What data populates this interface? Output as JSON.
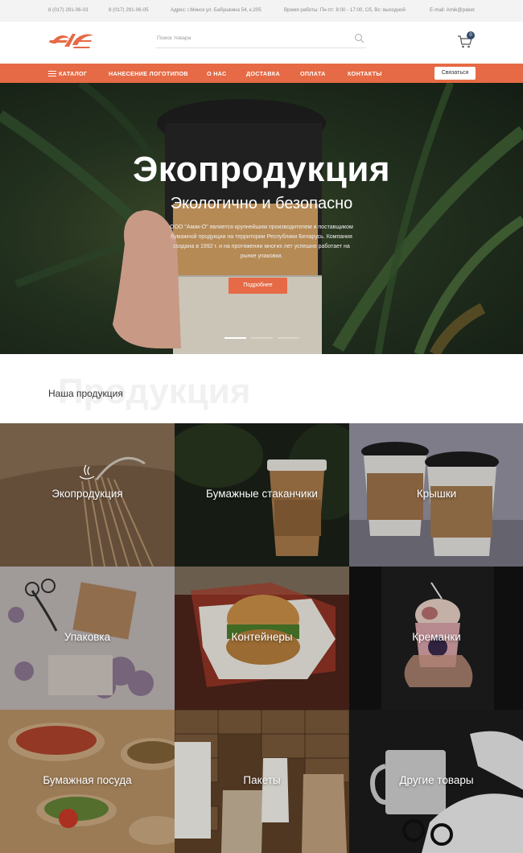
{
  "topbar": {
    "phone1": "8 (017) 291-06-03",
    "phone2": "8 (017) 291-06-05",
    "address": "Адрес: г.Минск ул. Бабушкина 54, к.205",
    "hours": "Время работы: Пн-пт: 8:00 - 17:00, Сб, Вс: выходной",
    "email": "E-mail: Amik@paket"
  },
  "header": {
    "search_placeholder": "Поиск товара",
    "cart_count": "0"
  },
  "nav": {
    "catalog": "КАТАЛОГ",
    "logos": "НАНЕСЕНИЕ ЛОГОТИПОВ",
    "about": "О НАС",
    "delivery": "ДОСТАВКА",
    "payment": "ОПЛАТА",
    "contacts": "КОНТАКТЫ",
    "contact_button": "Связаться"
  },
  "hero": {
    "title": "Экопродукция",
    "subtitle": "Экологично и безопасно",
    "text": "ООО \"Амик-О\" является крупнейшим производителем и поставщиком бумажной продукции на территории Республики Беларусь. Компания создана в 1992 г. и на протяжении многих лет успешно работает на рынке упаковки.",
    "button": "Подробнее",
    "slides_active_index": 0
  },
  "products": {
    "bg_text": "Продукция",
    "title": "Наша продукция",
    "items": [
      {
        "label": "Экопродукция"
      },
      {
        "label": "Бумажные стаканчики"
      },
      {
        "label": "Крышки"
      },
      {
        "label": "Упаковка"
      },
      {
        "label": "Контейнеры"
      },
      {
        "label": "Креманки"
      },
      {
        "label": "Бумажная посуда"
      },
      {
        "label": "Пакеты"
      },
      {
        "label": "Другие товары"
      }
    ]
  },
  "colors": {
    "accent": "#e66a45",
    "badge": "#334a6b",
    "topbar_bg": "#f3f3f3"
  }
}
